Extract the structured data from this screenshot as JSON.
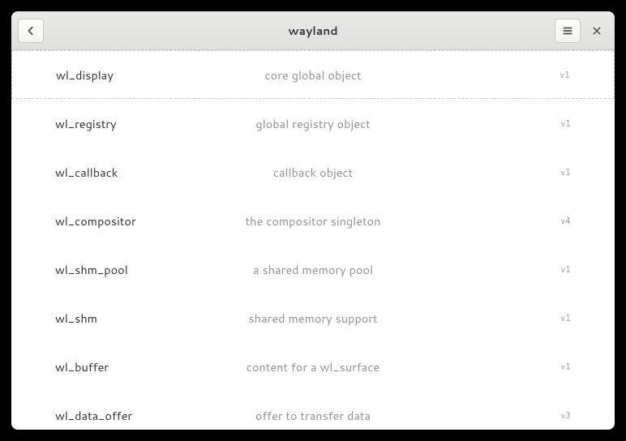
{
  "header": {
    "title": "wayland"
  },
  "interfaces": [
    {
      "name": "wl_display",
      "description": "core global object",
      "version": "v1",
      "selected": true
    },
    {
      "name": "wl_registry",
      "description": "global registry object",
      "version": "v1",
      "selected": false
    },
    {
      "name": "wl_callback",
      "description": "callback object",
      "version": "v1",
      "selected": false
    },
    {
      "name": "wl_compositor",
      "description": "the compositor singleton",
      "version": "v4",
      "selected": false
    },
    {
      "name": "wl_shm_pool",
      "description": "a shared memory pool",
      "version": "v1",
      "selected": false
    },
    {
      "name": "wl_shm",
      "description": "shared memory support",
      "version": "v1",
      "selected": false
    },
    {
      "name": "wl_buffer",
      "description": "content for a wl_surface",
      "version": "v1",
      "selected": false
    },
    {
      "name": "wl_data_offer",
      "description": "offer to transfer data",
      "version": "v3",
      "selected": false
    }
  ]
}
